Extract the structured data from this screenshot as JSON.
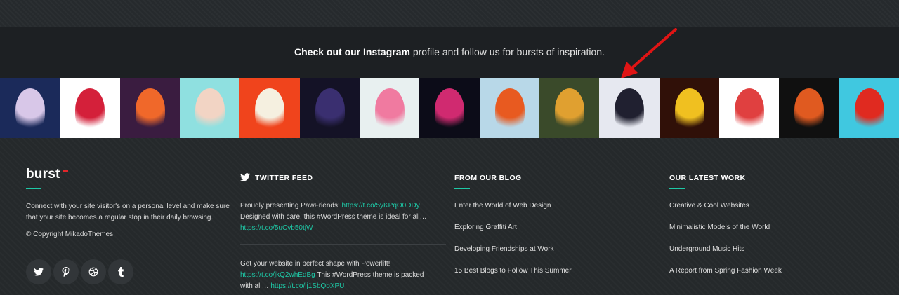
{
  "instagram": {
    "bold": "Check out our Instagram",
    "rest": " profile and follow us for bursts of inspiration."
  },
  "gallery": {
    "tiles": [
      {
        "label": "woman-blue-hair",
        "bg": "#1b2a5a",
        "fg": "#d8c7e8"
      },
      {
        "label": "woman-red-beanie",
        "bg": "#ffffff",
        "fg": "#d4203a"
      },
      {
        "label": "sunset-sea",
        "bg": "#3a1c40",
        "fg": "#f0682a"
      },
      {
        "label": "woman-camera",
        "bg": "#8fe0e0",
        "fg": "#f2d4c4"
      },
      {
        "label": "sneakers-orange",
        "bg": "#f0441c",
        "fg": "#f5f0e0"
      },
      {
        "label": "woman-dark-paint",
        "bg": "#141226",
        "fg": "#3a2f70"
      },
      {
        "label": "woman-pink-hair",
        "bg": "#e8f0f0",
        "fg": "#f07aa0"
      },
      {
        "label": "color-powder-burst",
        "bg": "#0c0c18",
        "fg": "#d02a70"
      },
      {
        "label": "woman-orange-vest",
        "bg": "#b8d8e8",
        "fg": "#e85a20"
      },
      {
        "label": "face-paint-closeup",
        "bg": "#3a4a2a",
        "fg": "#e0a030"
      },
      {
        "label": "woman-posing-white",
        "bg": "#e6e8f0",
        "fg": "#202030"
      },
      {
        "label": "man-colorful-lights",
        "bg": "#301008",
        "fg": "#f0c020"
      },
      {
        "label": "woman-red-cap",
        "bg": "#ffffff",
        "fg": "#e04040"
      },
      {
        "label": "orange-powder-burst",
        "bg": "#101010",
        "fg": "#e05a20"
      },
      {
        "label": "woman-white-hat",
        "bg": "#40c8e0",
        "fg": "#e02a20"
      }
    ]
  },
  "about": {
    "logo": "burst",
    "text": "Connect with your site visitor's on a personal level and make sure that your site becomes a regular stop in their daily browsing.",
    "copyright": "© Copyright MikadoThemes",
    "social": [
      {
        "icon": "twitter-icon"
      },
      {
        "icon": "pinterest-icon"
      },
      {
        "icon": "dribbble-icon"
      },
      {
        "icon": "tumblr-icon"
      }
    ]
  },
  "twitter": {
    "heading": "TWITTER FEED",
    "tweets": [
      {
        "t1": "Proudly presenting PawFriends! ",
        "l1": "https://t.co/5yKPqO0DDy",
        "t2": " Designed with care, this #WordPress theme is ideal for all… ",
        "l2": "https://t.co/5uCvb50tjW"
      },
      {
        "t1": "Get your website in perfect shape with Powerlift! ",
        "l1": "https://t.co/jkQ2whEdBg",
        "t2": " This #WordPress theme is packed with all… ",
        "l2": "https://t.co/lj1SbQbXPU"
      }
    ]
  },
  "blog": {
    "heading": "FROM OUR BLOG",
    "items": [
      "Enter the World of Web Design",
      "Exploring Graffiti Art",
      "Developing Friendships at Work",
      "15 Best Blogs to Follow This Summer"
    ]
  },
  "work": {
    "heading": "OUR LATEST WORK",
    "items": [
      "Creative & Cool Websites",
      "Minimalistic Models of the World",
      "Underground Music Hits",
      "A Report from Spring Fashion Week"
    ]
  },
  "colors": {
    "accent": "#1ec8a6",
    "arrow": "#e01414"
  }
}
